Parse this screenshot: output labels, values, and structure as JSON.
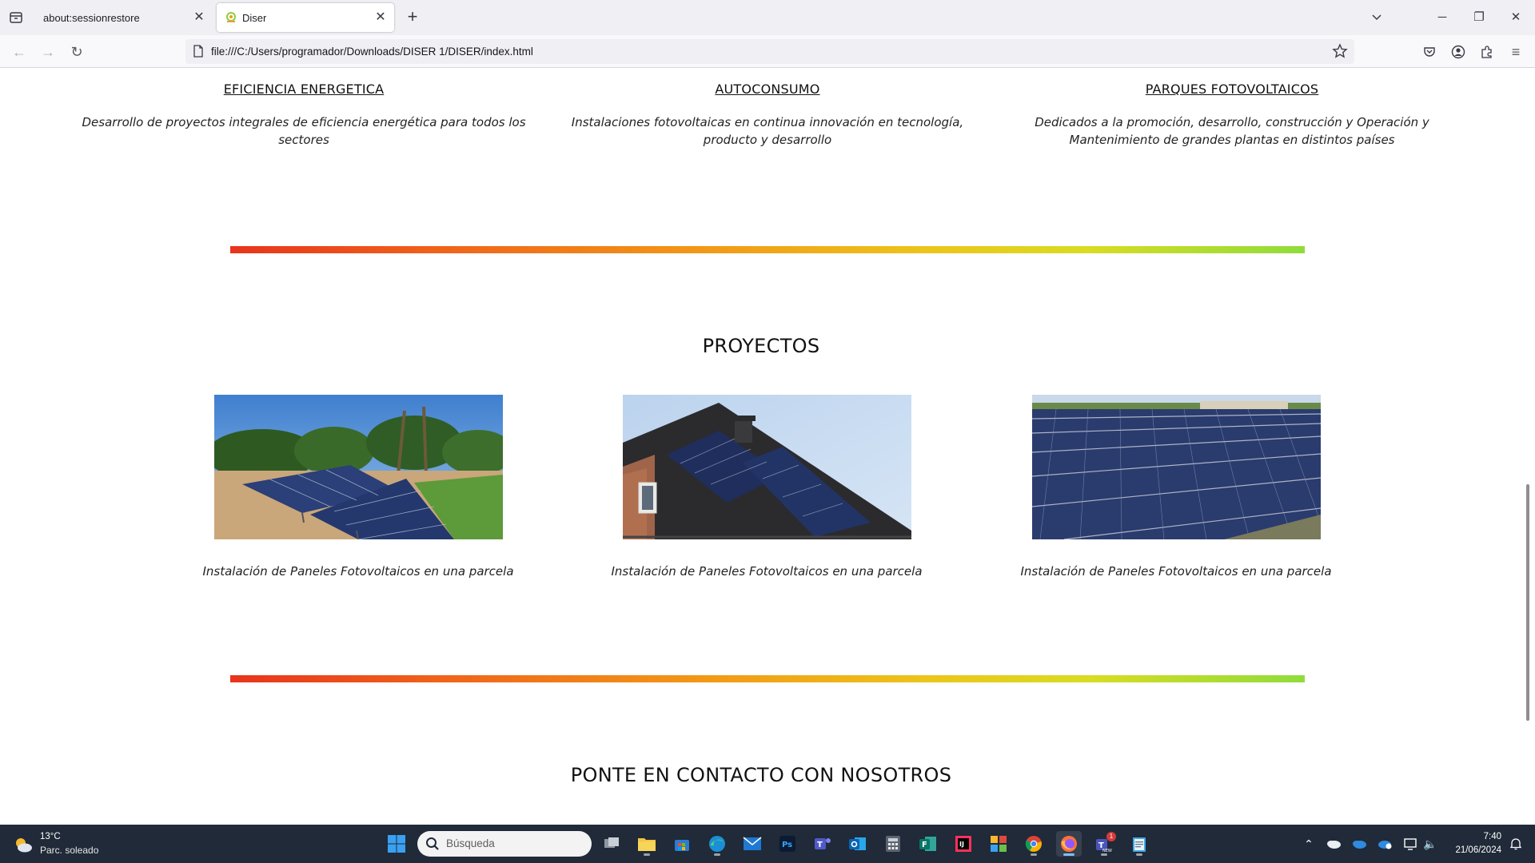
{
  "browser": {
    "tabs": [
      {
        "title": "about:sessionrestore",
        "active": false
      },
      {
        "title": "Diser",
        "active": true
      }
    ],
    "url": "file:///C:/Users/programador/Downloads/DISER 1/DISER/index.html",
    "icons": {
      "tab_list": "tab-list-icon",
      "back": "back-arrow-icon",
      "forward": "forward-arrow-icon",
      "reload": "reload-icon",
      "bookmark": "star-icon",
      "pocket": "pocket-icon",
      "account": "account-icon",
      "extensions": "extensions-icon",
      "menu": "hamburger-menu-icon"
    }
  },
  "services": [
    {
      "title": "EFICIENCIA ENERGETICA",
      "description": "Desarrollo de proyectos integrales de eficiencia energética para todos los sectores"
    },
    {
      "title": "AUTOCONSUMO",
      "description": "Instalaciones fotovoltaicas en continua innovación en tecnología, producto y desarrollo"
    },
    {
      "title": "PARQUES FOTOVOLTAICOS",
      "description": "Dedicados a la promoción, desarrollo, construcción y Operación y Mantenimiento de grandes plantas en distintos países"
    }
  ],
  "projects": {
    "title": "PROYECTOS",
    "items": [
      {
        "caption": "Instalación de Paneles Fotovoltaicos en una parcela",
        "image": "ground-mounted solar panels in a garden with palm trees"
      },
      {
        "caption": "Instalación de Paneles Fotovoltaicos en una parcela",
        "image": "solar panels on a house roof"
      },
      {
        "caption": "Instalación de Paneles Fotovoltaicos en una parcela",
        "image": "large solar farm panel rows"
      }
    ]
  },
  "contact": {
    "title": "PONTE EN CONTACTO CON NOSOTROS"
  },
  "colors": {
    "gradient_start": "#e8341c",
    "gradient_mid": "#f29a16",
    "gradient_end": "#8fdc3c",
    "taskbar": "#202a38"
  },
  "taskbar": {
    "weather": {
      "temp": "13°C",
      "condition": "Parc. soleado"
    },
    "search_placeholder": "Búsqueda",
    "apps": [
      "task-view",
      "file-explorer",
      "microsoft-store",
      "edge",
      "mail",
      "photoshop",
      "teams",
      "outlook",
      "calculator",
      "forms",
      "intellij",
      "start-menu-tiles",
      "chrome",
      "firefox",
      "teams-new",
      "notepad"
    ],
    "teams_badge": "1",
    "clock": {
      "time": "7:40",
      "date": "21/06/2024"
    }
  }
}
